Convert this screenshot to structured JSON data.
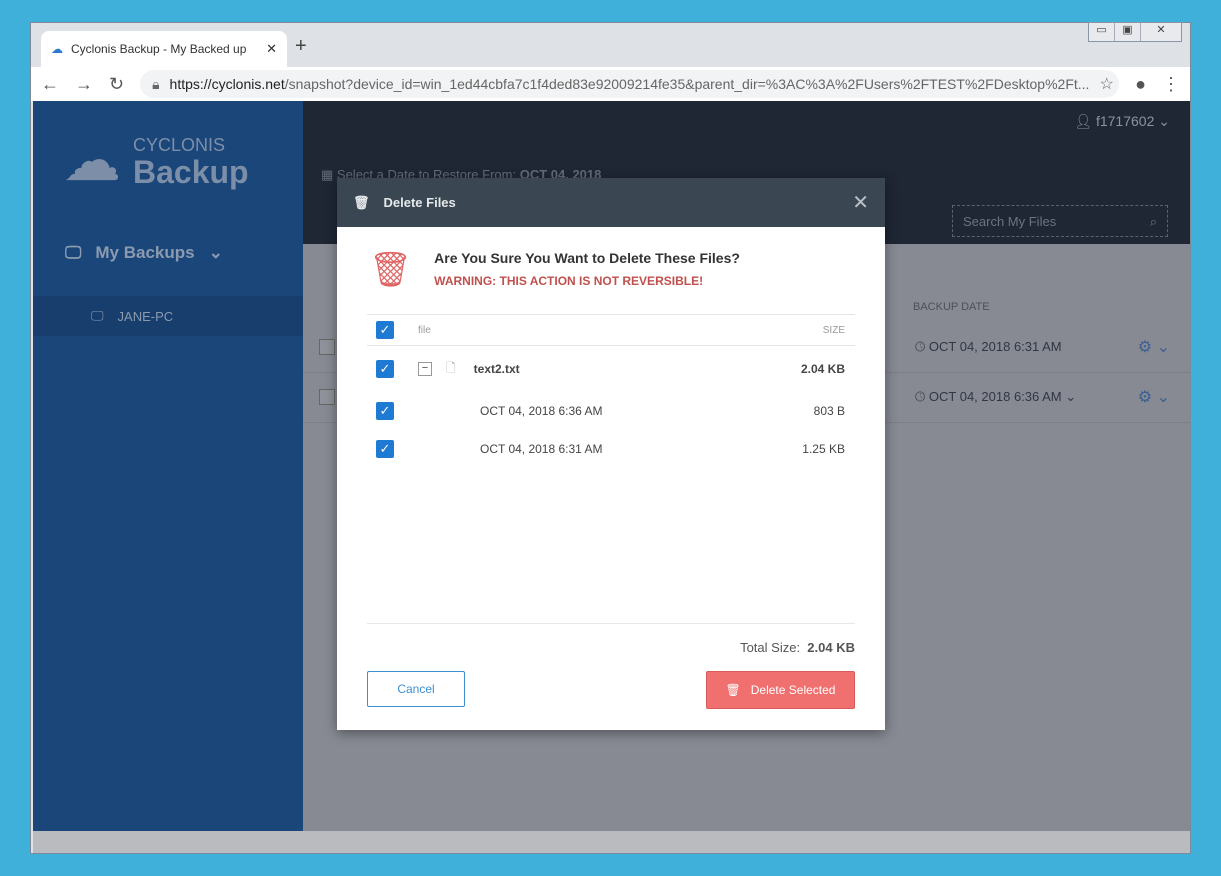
{
  "browser": {
    "tab_title": "Cyclonis Backup - My Backed up",
    "url_domain": "https://cyclonis.net",
    "url_rest": "/snapshot?device_id=win_1ed44cbfa7c1f4ded83e92009214fe35&parent_dir=%3AC%3A%2FUsers%2FTEST%2FDesktop%2Ft..."
  },
  "sidebar": {
    "logo_top": "CYCLONIS",
    "logo_bottom": "Backup",
    "my_backups": "My Backups",
    "device": "JANE-PC"
  },
  "header": {
    "user": "f1717602",
    "date_select_label": "Select a Date to Restore From:",
    "date_select_value": "OCT 04, 2018",
    "search_placeholder": "Search My Files"
  },
  "table": {
    "backup_date_header": "BACKUP DATE",
    "rows": [
      {
        "date": "OCT 04, 2018  6:31 AM"
      },
      {
        "date": "OCT 04, 2018  6:36 AM"
      }
    ]
  },
  "modal": {
    "title": "Delete Files",
    "question": "Are You Sure You Want to Delete These Files?",
    "warning": "WARNING: THIS ACTION IS NOT REVERSIBLE!",
    "col_file": "file",
    "col_size": "SIZE",
    "file": {
      "name": "text2.txt",
      "size": "2.04 KB"
    },
    "versions": [
      {
        "date": "OCT 04, 2018  6:36 AM",
        "size": "803 B"
      },
      {
        "date": "OCT 04, 2018  6:31 AM",
        "size": "1.25 KB"
      }
    ],
    "total_label": "Total Size:",
    "total_value": "2.04 KB",
    "cancel": "Cancel",
    "delete": "Delete Selected"
  },
  "colors": {
    "accent": "#1e7ad2",
    "danger": "#f07070",
    "sidebar": "#1b4679"
  }
}
